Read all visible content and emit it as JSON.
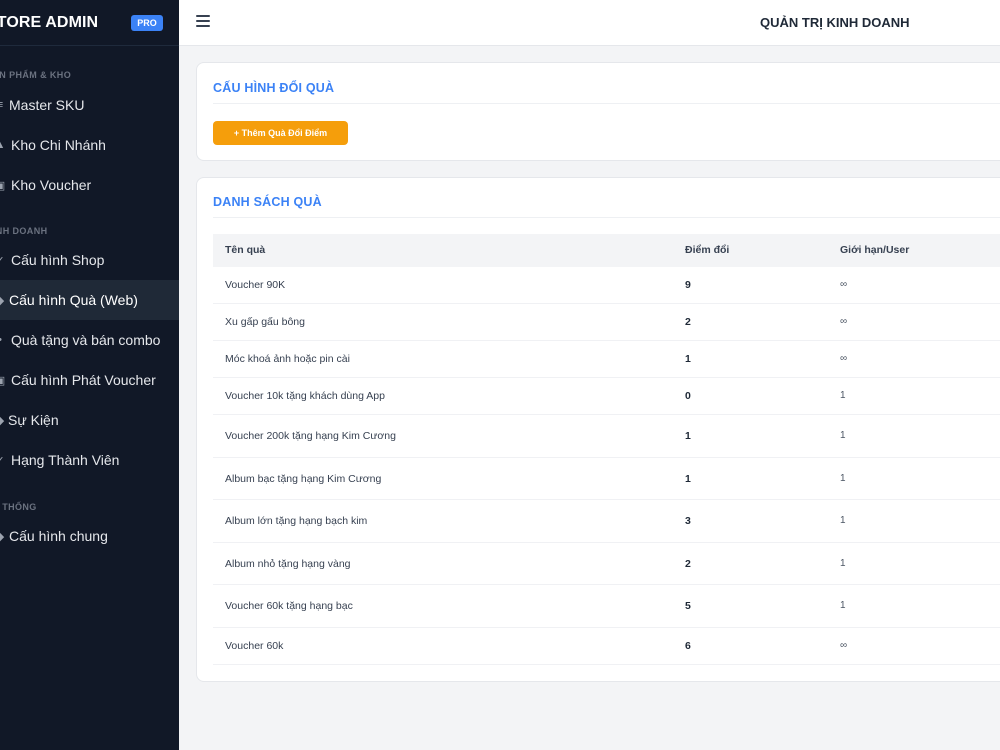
{
  "brand": {
    "title": "STORE ADMIN",
    "badge": "PRO"
  },
  "sidebar": {
    "sections": [
      {
        "label": "SẢN PHẨM & KHO"
      },
      {
        "label": "KINH DOANH"
      },
      {
        "label": "HỆ THỐNG"
      }
    ],
    "items": [
      {
        "label": "Master SKU",
        "icon": "≡"
      },
      {
        "label": "Kho Chi Nhánh",
        "icon": "▲"
      },
      {
        "label": "Kho Voucher",
        "icon": "▣"
      },
      {
        "label": "Cấu hình Shop",
        "icon": "✓"
      },
      {
        "label": "Cấu hình Quà (Web)",
        "icon": "◆"
      },
      {
        "label": "Quà tặng và bán combo",
        "icon": "•"
      },
      {
        "label": "Cấu hình Phát Voucher",
        "icon": "▣"
      },
      {
        "label": "Sự Kiện",
        "icon": "◆"
      },
      {
        "label": "Hạng Thành Viên",
        "icon": "✓"
      },
      {
        "label": "Cấu hình chung",
        "icon": "◆"
      }
    ]
  },
  "topbar": {
    "title": "QUẢN TRỊ KINH DOANH"
  },
  "config_card": {
    "title": "CẤU HÌNH ĐỔI QUÀ",
    "add_button": "+ Thêm Quà Đổi Điểm"
  },
  "list_card": {
    "title": "DANH SÁCH QUÀ",
    "columns": [
      "Tên quà",
      "Điểm đổi",
      "Giới hạn/User"
    ],
    "rows": [
      {
        "name": "Voucher 90K",
        "points": "9",
        "limit": "∞"
      },
      {
        "name": "Xu gấp gấu bông",
        "points": "2",
        "limit": "∞"
      },
      {
        "name": "Móc khoá ảnh hoặc pin cài",
        "points": "1",
        "limit": "∞"
      },
      {
        "name": "Voucher 10k tặng khách dùng App",
        "points": "0",
        "limit": "1"
      },
      {
        "name": "Voucher 200k tặng hạng Kim Cương",
        "points": "1",
        "limit": "1"
      },
      {
        "name": "Album bạc tặng hạng Kim Cương",
        "points": "1",
        "limit": "1"
      },
      {
        "name": "Album lớn tặng hạng bạch kim",
        "points": "3",
        "limit": "1"
      },
      {
        "name": "Album nhỏ tặng hạng vàng",
        "points": "2",
        "limit": "1"
      },
      {
        "name": "Voucher 60k tặng hạng bạc",
        "points": "5",
        "limit": "1"
      },
      {
        "name": "Voucher 60k",
        "points": "6",
        "limit": "∞"
      }
    ]
  },
  "colors": {
    "accent": "#3b82f6",
    "button": "#f59e0b",
    "sidebar": "#111827"
  }
}
